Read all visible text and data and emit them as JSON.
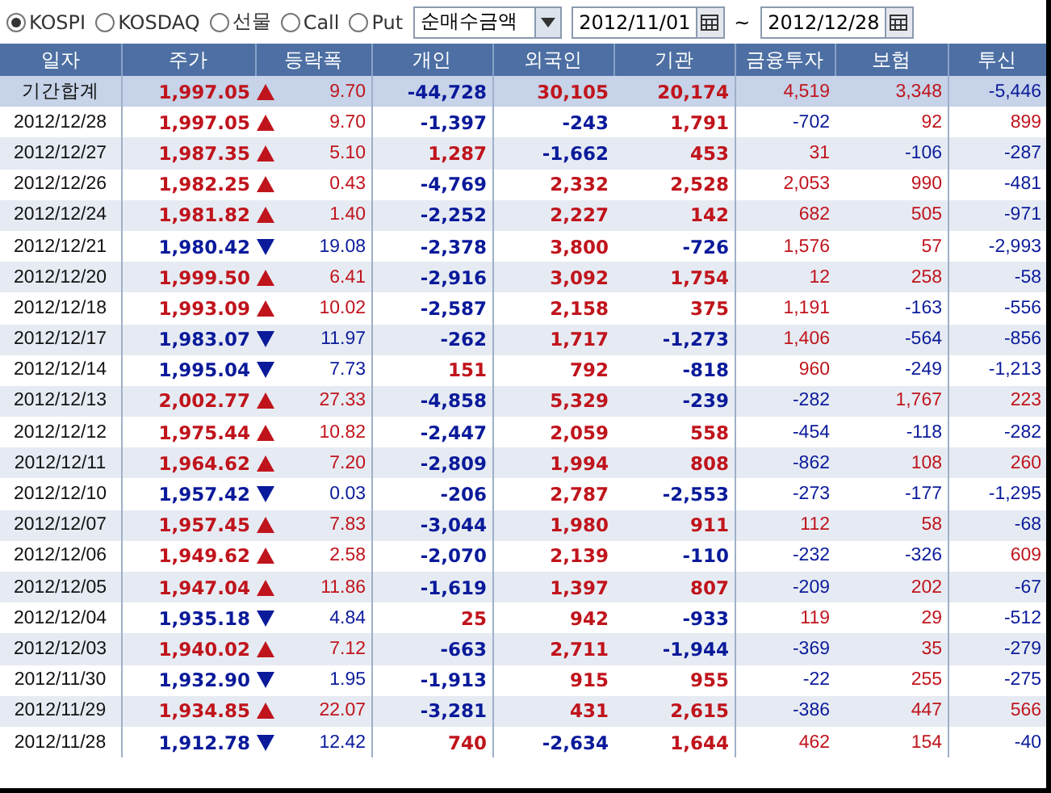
{
  "market_options": [
    {
      "label": "KOSPI",
      "selected": true
    },
    {
      "label": "KOSDAQ",
      "selected": false
    },
    {
      "label": "선물",
      "selected": false
    },
    {
      "label": "Call",
      "selected": false
    },
    {
      "label": "Put",
      "selected": false
    }
  ],
  "metric_select": {
    "value": "순매수금액"
  },
  "date_from": {
    "value": "2012/11/01"
  },
  "range_separator": "~",
  "date_to": {
    "value": "2012/12/28"
  },
  "table": {
    "columns": [
      "일자",
      "주가",
      "등락폭",
      "개인",
      "외국인",
      "기관",
      "금융투자",
      "보험",
      "투신"
    ],
    "rows": [
      {
        "kind": "total",
        "rising": true,
        "cells": [
          "기간합계",
          "1,997.05",
          "9.70",
          "-44,728",
          "30,105",
          "20,174",
          "4,519",
          "3,348",
          "-5,446"
        ]
      },
      {
        "kind": "day",
        "rising": true,
        "cells": [
          "2012/12/28",
          "1,997.05",
          "9.70",
          "-1,397",
          "-243",
          "1,791",
          "-702",
          "92",
          "899"
        ]
      },
      {
        "kind": "day",
        "rising": true,
        "cells": [
          "2012/12/27",
          "1,987.35",
          "5.10",
          "1,287",
          "-1,662",
          "453",
          "31",
          "-106",
          "-287"
        ]
      },
      {
        "kind": "day",
        "rising": true,
        "cells": [
          "2012/12/26",
          "1,982.25",
          "0.43",
          "-4,769",
          "2,332",
          "2,528",
          "2,053",
          "990",
          "-481"
        ]
      },
      {
        "kind": "day",
        "rising": true,
        "cells": [
          "2012/12/24",
          "1,981.82",
          "1.40",
          "-2,252",
          "2,227",
          "142",
          "682",
          "505",
          "-971"
        ]
      },
      {
        "kind": "day",
        "rising": false,
        "cells": [
          "2012/12/21",
          "1,980.42",
          "19.08",
          "-2,378",
          "3,800",
          "-726",
          "1,576",
          "57",
          "-2,993"
        ]
      },
      {
        "kind": "day",
        "rising": true,
        "cells": [
          "2012/12/20",
          "1,999.50",
          "6.41",
          "-2,916",
          "3,092",
          "1,754",
          "12",
          "258",
          "-58"
        ]
      },
      {
        "kind": "day",
        "rising": true,
        "cells": [
          "2012/12/18",
          "1,993.09",
          "10.02",
          "-2,587",
          "2,158",
          "375",
          "1,191",
          "-163",
          "-556"
        ]
      },
      {
        "kind": "day",
        "rising": false,
        "cells": [
          "2012/12/17",
          "1,983.07",
          "11.97",
          "-262",
          "1,717",
          "-1,273",
          "1,406",
          "-564",
          "-856"
        ]
      },
      {
        "kind": "day",
        "rising": false,
        "cells": [
          "2012/12/14",
          "1,995.04",
          "7.73",
          "151",
          "792",
          "-818",
          "960",
          "-249",
          "-1,213"
        ]
      },
      {
        "kind": "day",
        "rising": true,
        "cells": [
          "2012/12/13",
          "2,002.77",
          "27.33",
          "-4,858",
          "5,329",
          "-239",
          "-282",
          "1,767",
          "223"
        ]
      },
      {
        "kind": "day",
        "rising": true,
        "cells": [
          "2012/12/12",
          "1,975.44",
          "10.82",
          "-2,447",
          "2,059",
          "558",
          "-454",
          "-118",
          "-282"
        ]
      },
      {
        "kind": "day",
        "rising": true,
        "cells": [
          "2012/12/11",
          "1,964.62",
          "7.20",
          "-2,809",
          "1,994",
          "808",
          "-862",
          "108",
          "260"
        ]
      },
      {
        "kind": "day",
        "rising": false,
        "cells": [
          "2012/12/10",
          "1,957.42",
          "0.03",
          "-206",
          "2,787",
          "-2,553",
          "-273",
          "-177",
          "-1,295"
        ]
      },
      {
        "kind": "day",
        "rising": true,
        "cells": [
          "2012/12/07",
          "1,957.45",
          "7.83",
          "-3,044",
          "1,980",
          "911",
          "112",
          "58",
          "-68"
        ]
      },
      {
        "kind": "day",
        "rising": true,
        "cells": [
          "2012/12/06",
          "1,949.62",
          "2.58",
          "-2,070",
          "2,139",
          "-110",
          "-232",
          "-326",
          "609"
        ]
      },
      {
        "kind": "day",
        "rising": true,
        "cells": [
          "2012/12/05",
          "1,947.04",
          "11.86",
          "-1,619",
          "1,397",
          "807",
          "-209",
          "202",
          "-67"
        ]
      },
      {
        "kind": "day",
        "rising": false,
        "cells": [
          "2012/12/04",
          "1,935.18",
          "4.84",
          "25",
          "942",
          "-933",
          "119",
          "29",
          "-512"
        ]
      },
      {
        "kind": "day",
        "rising": true,
        "cells": [
          "2012/12/03",
          "1,940.02",
          "7.12",
          "-663",
          "2,711",
          "-1,944",
          "-369",
          "35",
          "-279"
        ]
      },
      {
        "kind": "day",
        "rising": false,
        "cells": [
          "2012/11/30",
          "1,932.90",
          "1.95",
          "-1,913",
          "915",
          "955",
          "-22",
          "255",
          "-275"
        ]
      },
      {
        "kind": "day",
        "rising": true,
        "cells": [
          "2012/11/29",
          "1,934.85",
          "22.07",
          "-3,281",
          "431",
          "2,615",
          "-386",
          "447",
          "566"
        ]
      },
      {
        "kind": "day",
        "rising": false,
        "cells": [
          "2012/11/28",
          "1,912.78",
          "12.42",
          "740",
          "-2,634",
          "1,644",
          "462",
          "154",
          "-40"
        ]
      }
    ]
  }
}
